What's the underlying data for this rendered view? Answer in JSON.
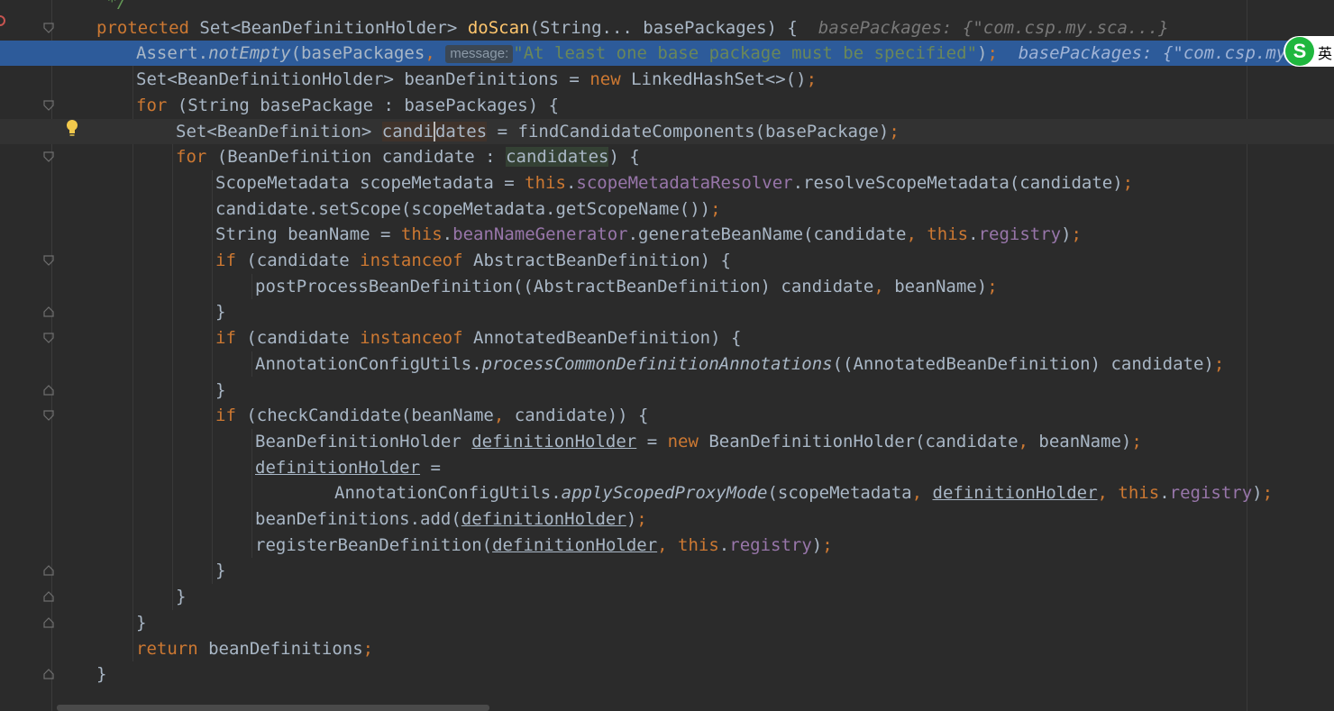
{
  "editor": {
    "lines": [
      {
        "id": "l0",
        "indent": 0,
        "segments": [
          {
            "text": " */",
            "cls": "cmt"
          }
        ]
      },
      {
        "id": "l1",
        "indent": 0,
        "segments": [
          {
            "text": "protected ",
            "cls": "kw"
          },
          {
            "text": "Set<BeanDefinitionHolder> "
          },
          {
            "text": "doScan",
            "cls": "fn-decl"
          },
          {
            "text": "(String... basePackages) {  "
          },
          {
            "text": "basePackages: {\"com.csp.my.sca...}",
            "cls": "hint"
          }
        ]
      },
      {
        "id": "l2",
        "indent": 1,
        "exec": true,
        "segments": [
          {
            "text": "Assert."
          },
          {
            "text": "notEmpty",
            "cls": "static"
          },
          {
            "text": "(basePackages"
          },
          {
            "text": ", ",
            "cls": "kw"
          },
          {
            "text": "message:",
            "cls": "inlay"
          },
          {
            "text": "\"At least one base package must be specified\"",
            "cls": "str"
          },
          {
            "text": ")"
          },
          {
            "text": ";",
            "cls": "kw"
          },
          {
            "text": "  basePackages: {\"com.csp.my.s",
            "cls": "hint"
          }
        ]
      },
      {
        "id": "l3",
        "indent": 1,
        "segments": [
          {
            "text": "Set<BeanDefinitionHolder> beanDefinitions = "
          },
          {
            "text": "new ",
            "cls": "kw"
          },
          {
            "text": "LinkedHashSet<>()"
          },
          {
            "text": ";",
            "cls": "kw"
          }
        ]
      },
      {
        "id": "l4",
        "indent": 1,
        "segments": [
          {
            "text": "for ",
            "cls": "kw"
          },
          {
            "text": "(String basePackage : basePackages) {"
          }
        ]
      },
      {
        "id": "l5",
        "indent": 2,
        "caret": true,
        "segments": [
          {
            "text": "Set<BeanDefinition> "
          },
          {
            "text": "candi",
            "cls": "hl-write"
          },
          {
            "text": "dates",
            "cls": "hl-write caret"
          },
          {
            "text": " = findCandidateComponents(basePackage)"
          },
          {
            "text": ";",
            "cls": "kw"
          }
        ]
      },
      {
        "id": "l6",
        "indent": 2,
        "segments": [
          {
            "text": "for ",
            "cls": "kw"
          },
          {
            "text": "(BeanDefinition candidate : "
          },
          {
            "text": "candidates",
            "cls": "hl-read"
          },
          {
            "text": ") {"
          }
        ]
      },
      {
        "id": "l7",
        "indent": 3,
        "segments": [
          {
            "text": "ScopeMetadata scopeMetadata = "
          },
          {
            "text": "this",
            "cls": "kw"
          },
          {
            "text": "."
          },
          {
            "text": "scopeMetadataResolver",
            "cls": "field"
          },
          {
            "text": ".resolveScopeMetadata(candidate)"
          },
          {
            "text": ";",
            "cls": "kw"
          }
        ]
      },
      {
        "id": "l8",
        "indent": 3,
        "segments": [
          {
            "text": "candidate.setScope(scopeMetadata.getScopeName())"
          },
          {
            "text": ";",
            "cls": "kw"
          }
        ]
      },
      {
        "id": "l9",
        "indent": 3,
        "segments": [
          {
            "text": "String beanName = "
          },
          {
            "text": "this",
            "cls": "kw"
          },
          {
            "text": "."
          },
          {
            "text": "beanNameGenerator",
            "cls": "field"
          },
          {
            "text": ".generateBeanName(candidate"
          },
          {
            "text": ", ",
            "cls": "kw"
          },
          {
            "text": "this",
            "cls": "kw"
          },
          {
            "text": "."
          },
          {
            "text": "registry",
            "cls": "field"
          },
          {
            "text": ")"
          },
          {
            "text": ";",
            "cls": "kw"
          }
        ]
      },
      {
        "id": "l10",
        "indent": 3,
        "segments": [
          {
            "text": "if ",
            "cls": "kw"
          },
          {
            "text": "(candidate "
          },
          {
            "text": "instanceof ",
            "cls": "kw"
          },
          {
            "text": "AbstractBeanDefinition) {"
          }
        ]
      },
      {
        "id": "l11",
        "indent": 4,
        "segments": [
          {
            "text": "postProcessBeanDefinition((AbstractBeanDefinition) candidate"
          },
          {
            "text": ", ",
            "cls": "kw"
          },
          {
            "text": "beanName)"
          },
          {
            "text": ";",
            "cls": "kw"
          }
        ]
      },
      {
        "id": "l12",
        "indent": 3,
        "segments": [
          {
            "text": "}"
          }
        ]
      },
      {
        "id": "l13",
        "indent": 3,
        "segments": [
          {
            "text": "if ",
            "cls": "kw"
          },
          {
            "text": "(candidate "
          },
          {
            "text": "instanceof ",
            "cls": "kw"
          },
          {
            "text": "AnnotatedBeanDefinition) {"
          }
        ]
      },
      {
        "id": "l14",
        "indent": 4,
        "segments": [
          {
            "text": "AnnotationConfigUtils."
          },
          {
            "text": "processCommonDefinitionAnnotations",
            "cls": "static"
          },
          {
            "text": "((AnnotatedBeanDefinition) candidate)"
          },
          {
            "text": ";",
            "cls": "kw"
          }
        ]
      },
      {
        "id": "l15",
        "indent": 3,
        "segments": [
          {
            "text": "}"
          }
        ]
      },
      {
        "id": "l16",
        "indent": 3,
        "segments": [
          {
            "text": "if ",
            "cls": "kw"
          },
          {
            "text": "(checkCandidate(beanName"
          },
          {
            "text": ", ",
            "cls": "kw"
          },
          {
            "text": "candidate)) {"
          }
        ]
      },
      {
        "id": "l17",
        "indent": 4,
        "segments": [
          {
            "text": "BeanDefinitionHolder "
          },
          {
            "text": "definitionHolder",
            "cls": "ul"
          },
          {
            "text": " = "
          },
          {
            "text": "new ",
            "cls": "kw"
          },
          {
            "text": "BeanDefinitionHolder(candidate"
          },
          {
            "text": ", ",
            "cls": "kw"
          },
          {
            "text": "beanName)"
          },
          {
            "text": ";",
            "cls": "kw"
          }
        ]
      },
      {
        "id": "l18",
        "indent": 4,
        "segments": [
          {
            "text": "definitionHolder",
            "cls": "ul"
          },
          {
            "text": " ="
          }
        ]
      },
      {
        "id": "l19",
        "indent": 6,
        "segments": [
          {
            "text": "AnnotationConfigUtils."
          },
          {
            "text": "applyScopedProxyMode",
            "cls": "static"
          },
          {
            "text": "(scopeMetadata"
          },
          {
            "text": ", ",
            "cls": "kw"
          },
          {
            "text": "definitionHolder",
            "cls": "ul"
          },
          {
            "text": ", ",
            "cls": "kw"
          },
          {
            "text": "this",
            "cls": "kw"
          },
          {
            "text": "."
          },
          {
            "text": "registry",
            "cls": "field"
          },
          {
            "text": ")"
          },
          {
            "text": ";",
            "cls": "kw"
          }
        ]
      },
      {
        "id": "l20",
        "indent": 4,
        "segments": [
          {
            "text": "beanDefinitions.add("
          },
          {
            "text": "definitionHolder",
            "cls": "ul"
          },
          {
            "text": ")"
          },
          {
            "text": ";",
            "cls": "kw"
          }
        ]
      },
      {
        "id": "l21",
        "indent": 4,
        "segments": [
          {
            "text": "registerBeanDefinition("
          },
          {
            "text": "definitionHolder",
            "cls": "ul"
          },
          {
            "text": ", ",
            "cls": "kw"
          },
          {
            "text": "this",
            "cls": "kw"
          },
          {
            "text": "."
          },
          {
            "text": "registry",
            "cls": "field"
          },
          {
            "text": ")"
          },
          {
            "text": ";",
            "cls": "kw"
          }
        ]
      },
      {
        "id": "l22",
        "indent": 3,
        "segments": [
          {
            "text": "}"
          }
        ]
      },
      {
        "id": "l23",
        "indent": 2,
        "segments": [
          {
            "text": "}"
          }
        ]
      },
      {
        "id": "l24",
        "indent": 1,
        "segments": [
          {
            "text": "}"
          }
        ]
      },
      {
        "id": "l25",
        "indent": 1,
        "segments": [
          {
            "text": "return ",
            "cls": "kw"
          },
          {
            "text": "beanDefinitions"
          },
          {
            "text": ";",
            "cls": "kw"
          }
        ]
      },
      {
        "id": "l26",
        "indent": 0,
        "segments": [
          {
            "text": "}"
          }
        ]
      }
    ]
  },
  "ime": {
    "logo_letter": "S",
    "language": "英"
  },
  "colors": {
    "background": "#2b2b2b",
    "keyword": "#cc7832",
    "string": "#6a8759",
    "field": "#9876aa",
    "method_decl": "#ffc66d",
    "execution_line": "#2d5b9a"
  },
  "icons": [
    "breakpoint-icon",
    "intention-bulb-icon",
    "fold-start-icon",
    "fold-end-icon"
  ]
}
